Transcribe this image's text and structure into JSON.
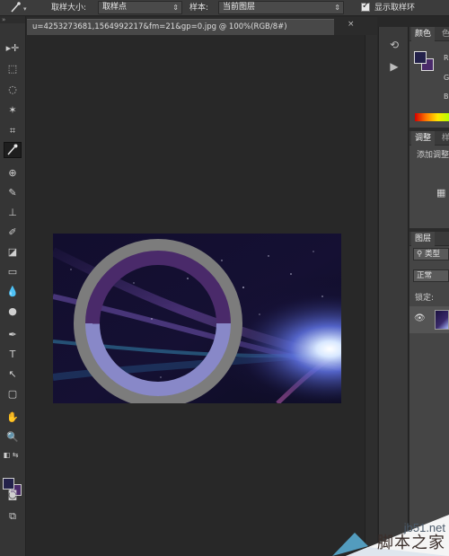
{
  "options_bar": {
    "sample_size_label": "取样大小:",
    "sample_size_value": "取样点",
    "sample_label": "样本:",
    "sample_value": "当前图层",
    "show_ring_label": "显示取样环"
  },
  "document": {
    "tab_title": "u=4253273681,1564992217&fm=21&gp=0.jpg @ 100%(RGB/8#)",
    "close_glyph": "×"
  },
  "panels": {
    "color": {
      "tab": "颜色",
      "r": "R",
      "g": "G",
      "b": "B",
      "fg": "#23214a",
      "bg": "#4a2a6a"
    },
    "adjust": {
      "tab": "调整",
      "other_tab": "样",
      "add_label": "添加调整"
    },
    "layers": {
      "tab": "图层",
      "filter": "类型",
      "blend": "正常",
      "lock": "锁定:"
    }
  },
  "toolbar": {
    "fg_color": "#23214a",
    "bg_color": "#4a2a6a",
    "tools": [
      "move-icon",
      "marquee-icon",
      "lasso-icon",
      "magic-wand-icon",
      "crop-icon",
      "eyedropper-icon",
      "healing-icon",
      "brush-icon",
      "stamp-icon",
      "history-brush-icon",
      "eraser-icon",
      "gradient-icon",
      "blur-icon",
      "dodge-icon",
      "pen-icon",
      "type-icon",
      "path-select-icon",
      "shape-icon",
      "hand-icon",
      "zoom-icon"
    ]
  },
  "watermark": {
    "line1": "jb51.net",
    "line2": "脚本之家"
  }
}
